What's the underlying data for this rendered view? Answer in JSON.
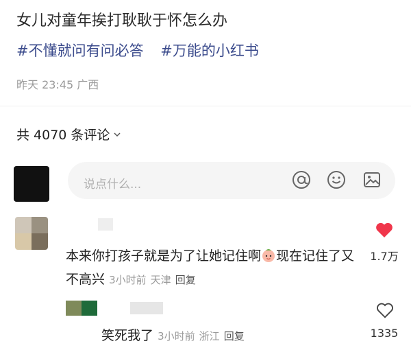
{
  "post": {
    "title": "女儿对童年挨打耿耿于怀怎么办",
    "tags": [
      "#不懂就问有问必答",
      "#万能的小红书"
    ],
    "meta": "昨天 23:45 广西"
  },
  "comments_header": {
    "count_label": "共 4070 条评论"
  },
  "input": {
    "placeholder": "说点什么..."
  },
  "icons": {
    "mention": "at-icon",
    "emoji": "smile-icon",
    "image": "image-icon",
    "like_filled": "heart-filled-icon",
    "like_outline": "heart-outline-icon"
  },
  "colors": {
    "tag": "#3b4b8c",
    "like": "#f0364b",
    "muted": "#9a9a9a"
  },
  "comments": [
    {
      "text_a": "本来你打孩子就是为了让她记住啊",
      "text_b": "现在记住了又不高兴",
      "time": "3小时前",
      "location": "天津",
      "reply": "回复",
      "likes": "1.7万",
      "liked": true
    },
    {
      "text": "笑死我了",
      "time": "3小时前",
      "location": "浙江",
      "reply": "回复",
      "likes": "1335",
      "liked": false
    }
  ]
}
